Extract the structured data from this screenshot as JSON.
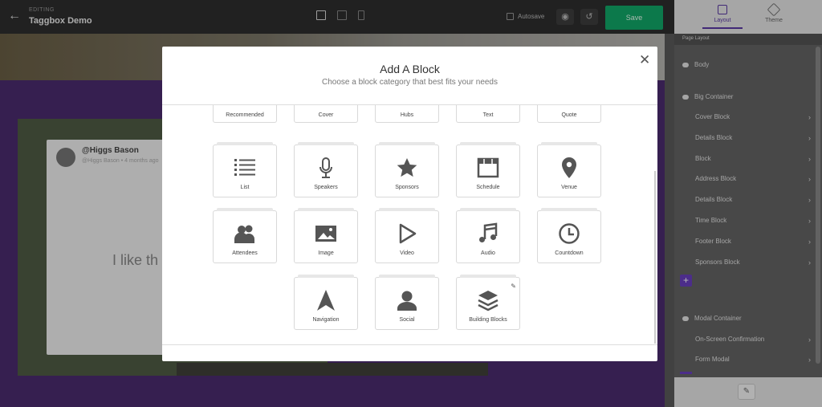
{
  "topbar": {
    "editing_label": "EDITING",
    "title": "Taggbox Demo",
    "autosave_label": "Autosave",
    "save_label": "Save",
    "back_icon": "arrow-left-icon"
  },
  "canvas": {
    "post_user": "@Higgs Bason",
    "post_meta": "@Higgs Bason • 4 months ago",
    "post_text": "I like th"
  },
  "sidebar": {
    "tabs": [
      {
        "label": "Layout",
        "active": true
      },
      {
        "label": "Theme",
        "active": false
      }
    ],
    "section_title": "Page Layout",
    "items": [
      {
        "label": "Body",
        "type": "root"
      },
      {
        "label": "Big Container",
        "type": "root"
      },
      {
        "label": "Cover Block",
        "type": "child"
      },
      {
        "label": "Details Block",
        "type": "child"
      },
      {
        "label": "Block",
        "type": "child"
      },
      {
        "label": "Address Block",
        "type": "child"
      },
      {
        "label": "Details Block",
        "type": "child"
      },
      {
        "label": "Time Block",
        "type": "child"
      },
      {
        "label": "Footer Block",
        "type": "child"
      },
      {
        "label": "Sponsors Block",
        "type": "child"
      },
      {
        "label": "Modal Container",
        "type": "root"
      },
      {
        "label": "On-Screen Confirmation",
        "type": "child"
      },
      {
        "label": "Form Modal",
        "type": "child"
      }
    ],
    "add_label": "+",
    "accent": "#6a3fc0"
  },
  "modal": {
    "title": "Add A Block",
    "subtitle": "Choose a block category that best fits your needs",
    "categories": [
      {
        "label": "Recommended",
        "icon": ""
      },
      {
        "label": "Cover",
        "icon": ""
      },
      {
        "label": "Hubs",
        "icon": ""
      },
      {
        "label": "Text",
        "icon": ""
      },
      {
        "label": "Quote",
        "icon": ""
      },
      {
        "label": "List",
        "icon": "list-icon"
      },
      {
        "label": "Speakers",
        "icon": "microphone-icon"
      },
      {
        "label": "Sponsors",
        "icon": "star-icon"
      },
      {
        "label": "Schedule",
        "icon": "calendar-icon"
      },
      {
        "label": "Venue",
        "icon": "map-pin-icon"
      },
      {
        "label": "Attendees",
        "icon": "users-icon"
      },
      {
        "label": "Image",
        "icon": "image-icon"
      },
      {
        "label": "Video",
        "icon": "play-icon"
      },
      {
        "label": "Audio",
        "icon": "music-note-icon"
      },
      {
        "label": "Countdown",
        "icon": "clock-icon"
      },
      {
        "label": "Navigation",
        "icon": "navigation-arrow-icon"
      },
      {
        "label": "Social",
        "icon": "person-icon"
      },
      {
        "label": "Building Blocks",
        "icon": "layers-icon"
      }
    ]
  },
  "colors": {
    "save_green": "#11a868",
    "canvas_purple": "#4b2c6f"
  }
}
